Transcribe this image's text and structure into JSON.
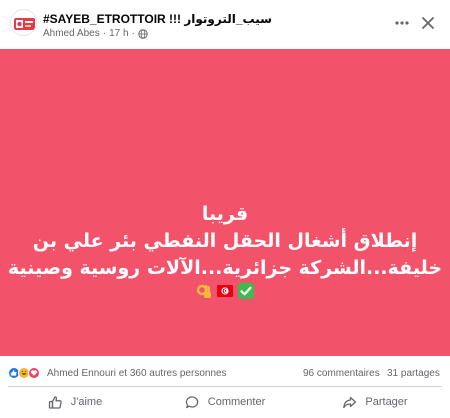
{
  "post": {
    "page_name": "#SAYEB_ETROTTOIR !!! سيب_التروتوار",
    "author": "Ahmed Abes",
    "time": "17 h",
    "separator": "·"
  },
  "image_text": {
    "line1": "قريبا",
    "line2": "إنطلاق أشغال الحقل النفطي بئر علي بن",
    "line3": "خليفة...الشركة جزائرية...الآلات روسية وصينية",
    "emojis": [
      "ok-hand-icon",
      "tunisia-flag-icon",
      "check-mark-icon"
    ]
  },
  "summary": {
    "reactors": "Ahmed Ennouri et 360 autres personnes",
    "comments": "96 commentaires",
    "shares": "31 partages"
  },
  "actions": {
    "like": "J'aime",
    "comment": "Commenter",
    "share": "Partager"
  },
  "colors": {
    "post_background": "#f2536a",
    "secondary_text": "#65676b",
    "like_blue": "#1877f2"
  }
}
